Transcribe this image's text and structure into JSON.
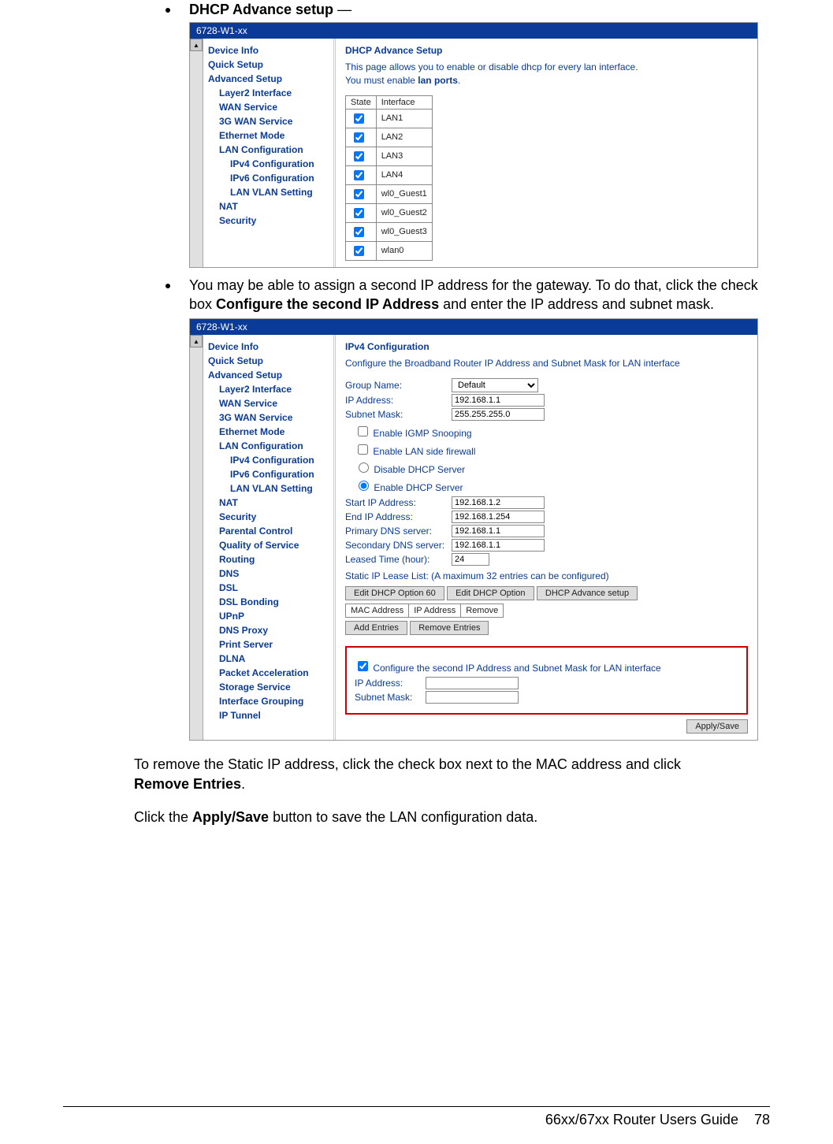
{
  "bullets": {
    "b1_bold": "DHCP Advance setup",
    "b1_tail": " —",
    "b2_pre": "You may be able to assign a second IP address for the gateway.  To do that, click the check box ",
    "b2_bold": "Configure the second IP Address",
    "b2_post": " and enter the IP address and subnet mask."
  },
  "shot1": {
    "title": "6728-W1-xx",
    "nav": [
      "Device Info",
      "Quick Setup",
      "Advanced Setup"
    ],
    "nav_sub": [
      "Layer2 Interface",
      "WAN Service",
      "3G WAN Service",
      "Ethernet Mode",
      "LAN Configuration"
    ],
    "nav_sub2": [
      "IPv4 Configuration",
      "IPv6 Configuration",
      "LAN VLAN Setting"
    ],
    "nav_tail": [
      "NAT",
      "Security"
    ],
    "panel_title": "DHCP Advance Setup",
    "panel_desc1": "This page allows you to enable or disable dhcp for every lan interface.",
    "panel_desc2": "You must enable lan ports.",
    "table_headers": [
      "State",
      "Interface"
    ],
    "rows": [
      "LAN1",
      "LAN2",
      "LAN3",
      "LAN4",
      "wl0_Guest1",
      "wl0_Guest2",
      "wl0_Guest3",
      "wlan0"
    ]
  },
  "shot2": {
    "title": "6728-W1-xx",
    "nav": [
      "Device Info",
      "Quick Setup",
      "Advanced Setup"
    ],
    "nav_sub": [
      "Layer2 Interface",
      "WAN Service",
      "3G WAN Service",
      "Ethernet Mode",
      "LAN Configuration"
    ],
    "nav_sub2": [
      "IPv4 Configuration",
      "IPv6 Configuration",
      "LAN VLAN Setting"
    ],
    "nav_tail": [
      "NAT",
      "Security",
      "Parental Control",
      "Quality of Service",
      "Routing",
      "DNS",
      "DSL",
      "DSL Bonding",
      "UPnP",
      "DNS Proxy",
      "Print Server",
      "DLNA",
      "Packet Acceleration",
      "Storage Service",
      "Interface Grouping",
      "IP Tunnel"
    ],
    "panel_title": "IPv4 Configuration",
    "panel_sub": "Configure the Broadband Router IP Address and Subnet Mask for LAN interface",
    "labels": {
      "group": "Group Name:",
      "ip": "IP Address:",
      "mask": "Subnet Mask:",
      "igmp": "Enable IGMP Snooping",
      "fw": "Enable LAN side firewall",
      "dis": "Disable DHCP Server",
      "en": "Enable DHCP Server",
      "start": "Start IP Address:",
      "end": "End IP Address:",
      "pdns": "Primary DNS server:",
      "sdns": "Secondary DNS server:",
      "lease": "Leased Time (hour):",
      "static": "Static IP Lease List: (A maximum 32 entries can be configured)",
      "mac_h": "MAC Address",
      "ip_h": "IP Address",
      "rem_h": "Remove",
      "second": "Configure the second IP Address and Subnet Mask for LAN interface",
      "ip2": "IP Address:",
      "mask2": "Subnet Mask:"
    },
    "values": {
      "group": "Default",
      "ip": "192.168.1.1",
      "mask": "255.255.255.0",
      "start": "192.168.1.2",
      "end": "192.168.1.254",
      "pdns": "192.168.1.1",
      "sdns": "192.168.1.1",
      "lease": "24"
    },
    "buttons": {
      "opt60": "Edit DHCP Option 60",
      "opt": "Edit DHCP Option",
      "adv": "DHCP Advance setup",
      "add": "Add Entries",
      "remove": "Remove Entries",
      "apply": "Apply/Save"
    }
  },
  "para1_pre": "To remove the Static IP address, click the check box next to the MAC address and click ",
  "para1_bold": "Remove Entries",
  "para1_post": ".",
  "para2_pre": "Click the ",
  "para2_bold": "Apply/Save",
  "para2_post": " button to save the LAN configuration data.",
  "footer_text": "66xx/67xx Router Users Guide",
  "footer_page": "78"
}
